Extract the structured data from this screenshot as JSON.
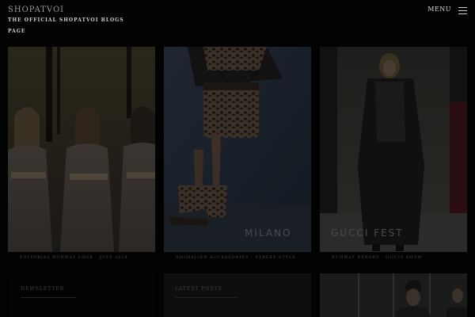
{
  "site": {
    "name": "SHOPATVOI",
    "tagline_line1": "THE OFFICIAL SHOPATVOI BLOGS",
    "tagline_line2": "PAGE",
    "menu_label": "MENU"
  },
  "posts": [
    {
      "caption": "EDITORIAL RUNWAY LOOK · JULY 2014",
      "overlay": ""
    },
    {
      "caption": "ANIMALIER ACCESSORIES · STREET STYLE",
      "overlay": "MILANO"
    },
    {
      "caption": "RUNWAY REPORT · GUCCI SHOW",
      "overlay": "GUCCI FEST"
    }
  ],
  "bottom_cards": [
    {
      "title": "NEWSLETTER"
    },
    {
      "title": "LATEST POSTS"
    }
  ],
  "colors": {
    "background": "#020202",
    "text_muted": "#4a4a4a",
    "text_light": "#d8d8d8"
  }
}
